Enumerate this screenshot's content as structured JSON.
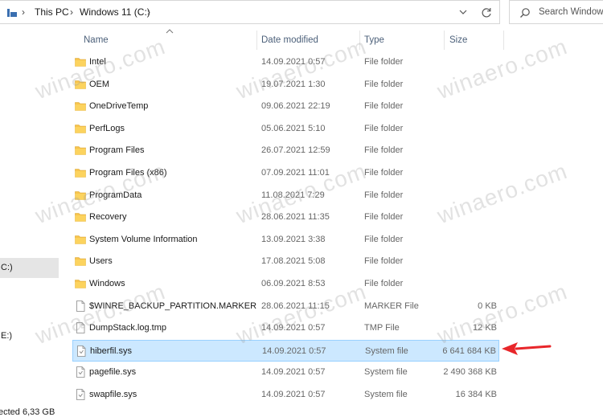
{
  "address_bar": {
    "crumbs": [
      "This PC",
      "Windows 11 (C:)"
    ],
    "search_placeholder": "Search Windows"
  },
  "nav_pane": {
    "items": [
      {
        "label": "C:)",
        "selected": true
      },
      {
        "label": "E:)",
        "selected": false
      },
      {
        "label": "ected  6,33 GB",
        "selected": false
      }
    ]
  },
  "columns": {
    "name": "Name",
    "date": "Date modified",
    "type": "Type",
    "size": "Size"
  },
  "files": [
    {
      "name": "Intel",
      "date": "14.09.2021 0:57",
      "type": "File folder",
      "size": "",
      "icon": "folder-icon"
    },
    {
      "name": "OEM",
      "date": "19.07.2021 1:30",
      "type": "File folder",
      "size": "",
      "icon": "folder-icon"
    },
    {
      "name": "OneDriveTemp",
      "date": "09.06.2021 22:19",
      "type": "File folder",
      "size": "",
      "icon": "folder-icon"
    },
    {
      "name": "PerfLogs",
      "date": "05.06.2021 5:10",
      "type": "File folder",
      "size": "",
      "icon": "folder-icon"
    },
    {
      "name": "Program Files",
      "date": "26.07.2021 12:59",
      "type": "File folder",
      "size": "",
      "icon": "folder-icon"
    },
    {
      "name": "Program Files (x86)",
      "date": "07.09.2021 11:01",
      "type": "File folder",
      "size": "",
      "icon": "folder-icon"
    },
    {
      "name": "ProgramData",
      "date": "11.08.2021 7:29",
      "type": "File folder",
      "size": "",
      "icon": "folder-icon"
    },
    {
      "name": "Recovery",
      "date": "28.06.2021 11:35",
      "type": "File folder",
      "size": "",
      "icon": "folder-icon"
    },
    {
      "name": "System Volume Information",
      "date": "13.09.2021 3:38",
      "type": "File folder",
      "size": "",
      "icon": "folder-icon"
    },
    {
      "name": "Users",
      "date": "17.08.2021 5:08",
      "type": "File folder",
      "size": "",
      "icon": "folder-icon"
    },
    {
      "name": "Windows",
      "date": "06.09.2021 8:53",
      "type": "File folder",
      "size": "",
      "icon": "folder-icon"
    },
    {
      "name": "$WINRE_BACKUP_PARTITION.MARKER",
      "date": "28.06.2021 11:15",
      "type": "MARKER File",
      "size": "0 KB",
      "icon": "file-icon"
    },
    {
      "name": "DumpStack.log.tmp",
      "date": "14.09.2021 0:57",
      "type": "TMP File",
      "size": "12 KB",
      "icon": "file-icon"
    },
    {
      "name": "hiberfil.sys",
      "date": "14.09.2021 0:57",
      "type": "System file",
      "size": "6 641 684 KB",
      "icon": "system-file-icon",
      "selected": true
    },
    {
      "name": "pagefile.sys",
      "date": "14.09.2021 0:57",
      "type": "System file",
      "size": "2 490 368 KB",
      "icon": "system-file-icon"
    },
    {
      "name": "swapfile.sys",
      "date": "14.09.2021 0:57",
      "type": "System file",
      "size": "16 384 KB",
      "icon": "system-file-icon"
    }
  ],
  "watermark": "winaero.com",
  "colors": {
    "selection_bg": "#cce8ff",
    "selection_border": "#99d1ff",
    "folder": "#f8c44d",
    "arrow": "#e8262a"
  }
}
